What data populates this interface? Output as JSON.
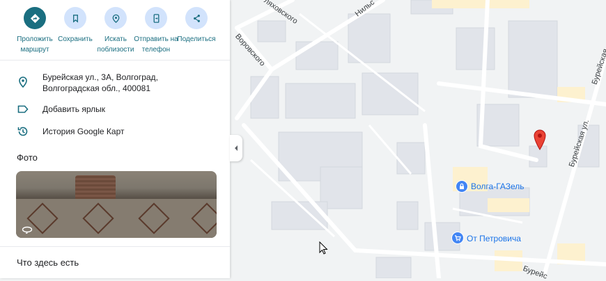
{
  "actions": [
    {
      "label": "Проложить маршрут",
      "icon": "directions-icon",
      "primary": true
    },
    {
      "label": "Сохранить",
      "icon": "bookmark-icon",
      "primary": false
    },
    {
      "label": "Искать поблизости",
      "icon": "nearby-search-icon",
      "primary": false
    },
    {
      "label": "Отправить на телефон",
      "icon": "send-to-phone-icon",
      "primary": false
    },
    {
      "label": "Поделиться",
      "icon": "share-icon",
      "primary": false
    }
  ],
  "details": {
    "address": "Бурейская ул., 3А, Волгоград, Волгоградская обл., 400081",
    "add_label": "Добавить ярлык",
    "history": "История Google Карт"
  },
  "photo_section": {
    "title": "Фото"
  },
  "whats_here": {
    "title": "Что здесь есть"
  },
  "map": {
    "street_labels": [
      "ляховского",
      "Нильс",
      "Воровского",
      "Бурейская ул.",
      "Бурейская",
      "Бурейс"
    ],
    "pois": [
      {
        "name": "Волга-ГАЗель",
        "icon": "lock-icon"
      },
      {
        "name": "От Петровича",
        "icon": "shopping-cart-icon"
      }
    ],
    "colors": {
      "panel_accent": "#1a6e80",
      "action_bg": "#d2e3fc",
      "poi_blue": "#4285f4",
      "pin_red": "#ea4335",
      "map_bg": "#f1f3f4",
      "building": "#e1e4ea",
      "road": "#ffffff",
      "highlight_yellow": "#fdf1cf"
    }
  }
}
